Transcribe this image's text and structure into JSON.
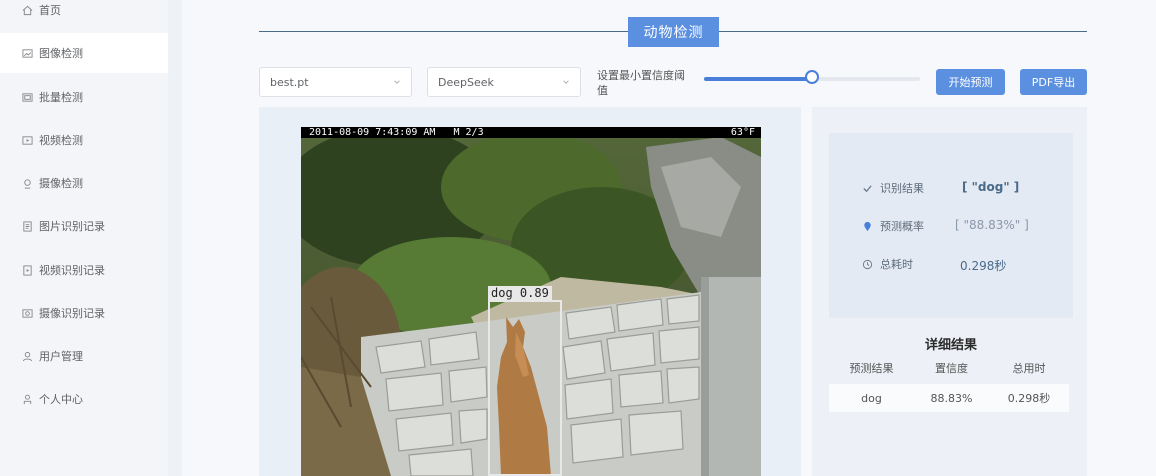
{
  "sidebar": {
    "items": [
      {
        "label": "首页",
        "icon": "home-icon"
      },
      {
        "label": "图像检测",
        "icon": "image-icon"
      },
      {
        "label": "批量检测",
        "icon": "batch-icon"
      },
      {
        "label": "视频检测",
        "icon": "video-icon"
      },
      {
        "label": "摄像检测",
        "icon": "camera-icon"
      },
      {
        "label": "图片识别记录",
        "icon": "image-record-icon"
      },
      {
        "label": "视频识别记录",
        "icon": "video-record-icon"
      },
      {
        "label": "摄像识别记录",
        "icon": "camera-record-icon"
      },
      {
        "label": "用户管理",
        "icon": "user-icon"
      },
      {
        "label": "个人中心",
        "icon": "person-icon"
      }
    ],
    "active_index": 1
  },
  "page": {
    "title": "动物检测"
  },
  "toolbar": {
    "model_select": "best.pt",
    "llm_select": "DeepSeek",
    "confidence_label": "设置最小置信度阈值",
    "confidence_value": 0.5,
    "start_button": "开始预测",
    "pdf_button": "PDF导出"
  },
  "image": {
    "timestamp": "2011-08-09 7:43:09 AM   M 2/3",
    "temperature": "63°F",
    "detection_label": "dog 0.89"
  },
  "summary": {
    "result_label": "识别结果",
    "result_value": "[ \"dog\" ]",
    "prob_label": "预测概率",
    "prob_value": "[ \"88.83%\" ]",
    "time_label": "总耗时",
    "time_value": "0.298秒"
  },
  "details": {
    "title": "详细结果",
    "headers": [
      "预测结果",
      "置信度",
      "总用时"
    ],
    "rows": [
      [
        "dog",
        "88.83%",
        "0.298秒"
      ]
    ]
  },
  "colors": {
    "accent": "#5b8fe0",
    "slider": "#4a7fd9"
  }
}
